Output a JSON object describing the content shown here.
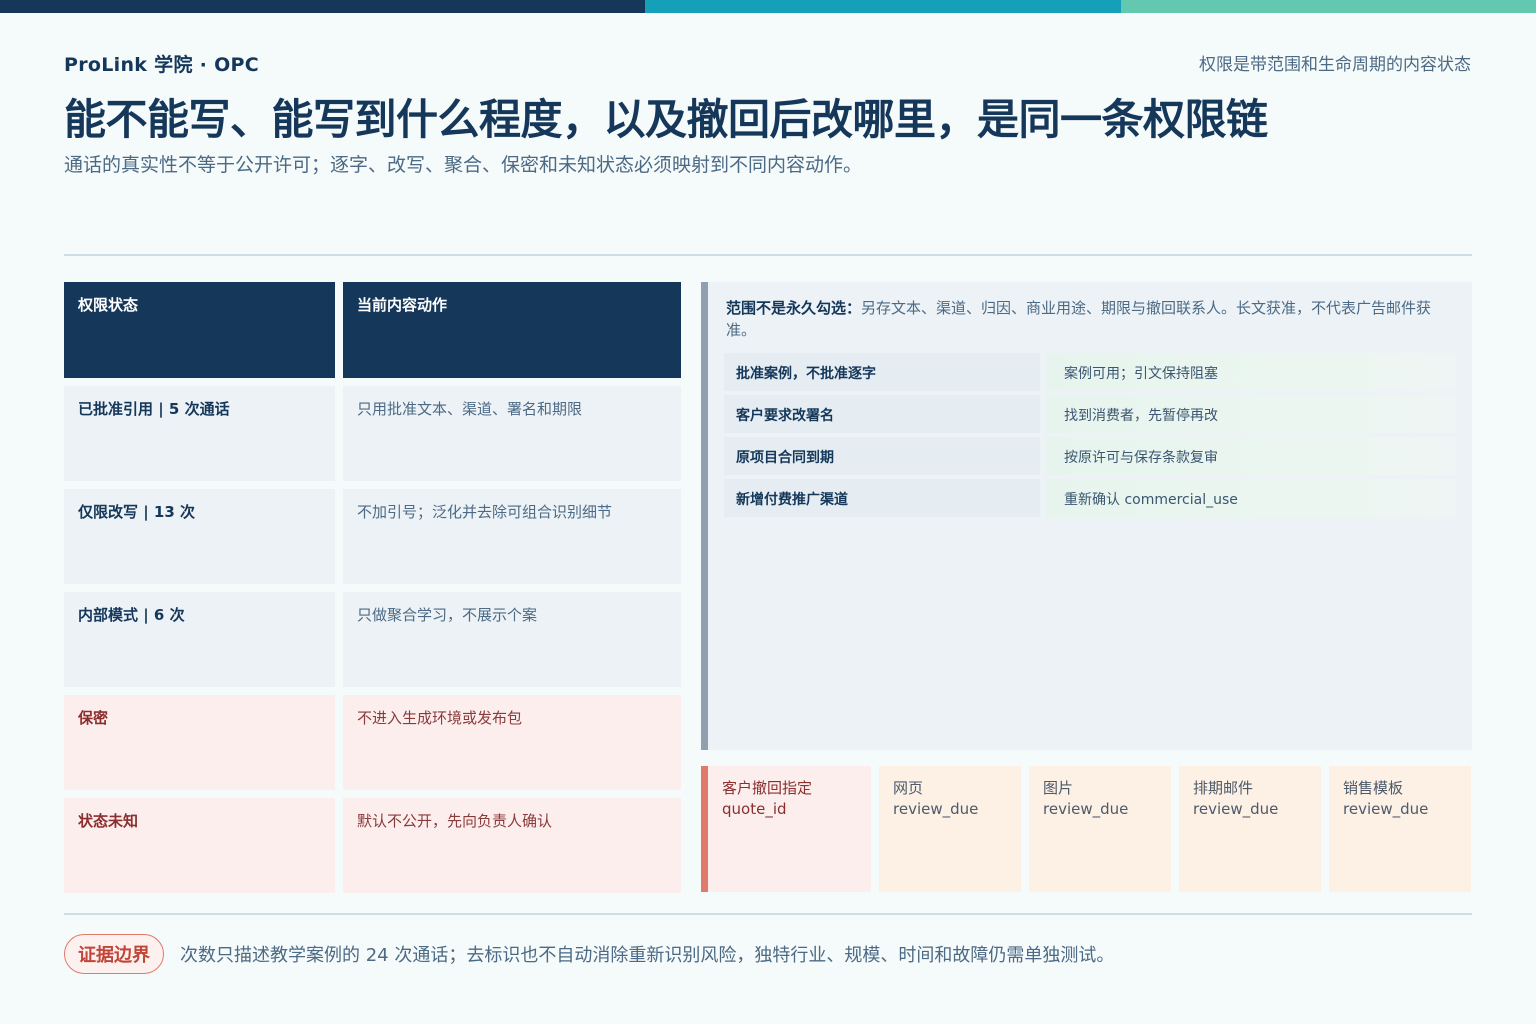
{
  "header": {
    "brand": "ProLink 学院 · OPC",
    "topic": "权限是带范围和生命周期的内容状态",
    "title": "能不能写、能写到什么程度，以及撤回后改哪里，是同一条权限链",
    "subtitle": "通话的真实性不等于公开许可；逐字、改写、聚合、保密和未知状态必须映射到不同内容动作。"
  },
  "table": {
    "headers": [
      "权限状态",
      "当前内容动作"
    ],
    "rows": [
      {
        "state": "已批准引用 | 5 次通话",
        "action": "只用批准文本、渠道、署名和期限",
        "tone": "neutral"
      },
      {
        "state": "仅限改写 | 13 次",
        "action": "不加引号；泛化并去除可组合识别细节",
        "tone": "neutral"
      },
      {
        "state": "内部模式 | 6 次",
        "action": "只做聚合学习，不展示个案",
        "tone": "neutral"
      },
      {
        "state": "保密",
        "action": "不进入生成环境或发布包",
        "tone": "warn"
      },
      {
        "state": "状态未知",
        "action": "默认不公开，先向负责人确认",
        "tone": "warn"
      }
    ]
  },
  "panel": {
    "note_label": "范围不是永久勾选：",
    "note_text": "另存文本、渠道、归因、商业用途、期限与撤回联系人。长文获准，不代表广告邮件获准。",
    "rules": [
      {
        "case": "批准案例，不批准逐字",
        "action": "案例可用；引文保持阻塞"
      },
      {
        "case": "客户要求改署名",
        "action": "找到消费者，先暂停再改"
      },
      {
        "case": "原项目合同到期",
        "action": "按原许可与保存条款复审"
      },
      {
        "case": "新增付费推广渠道",
        "action": "重新确认 commercial_use"
      }
    ]
  },
  "cards": [
    {
      "title": "客户撤回指定",
      "code": "quote_id",
      "tone": "alert"
    },
    {
      "title": "网页",
      "code": "review_due",
      "tone": "soft"
    },
    {
      "title": "图片",
      "code": "review_due",
      "tone": "soft"
    },
    {
      "title": "排期邮件",
      "code": "review_due",
      "tone": "soft"
    },
    {
      "title": "销售模板",
      "code": "review_due",
      "tone": "soft"
    }
  ],
  "footer": {
    "badge": "证据边界",
    "note": "次数只描述教学案例的 24 次通话；去标识也不自动消除重新识别风险，独特行业、规模、时间和故障仍需单独测试。"
  },
  "colors": {
    "navy": "#15375a",
    "teal": "#13a0b8",
    "mint": "#62c8b0",
    "alert": "#e07a6a"
  }
}
